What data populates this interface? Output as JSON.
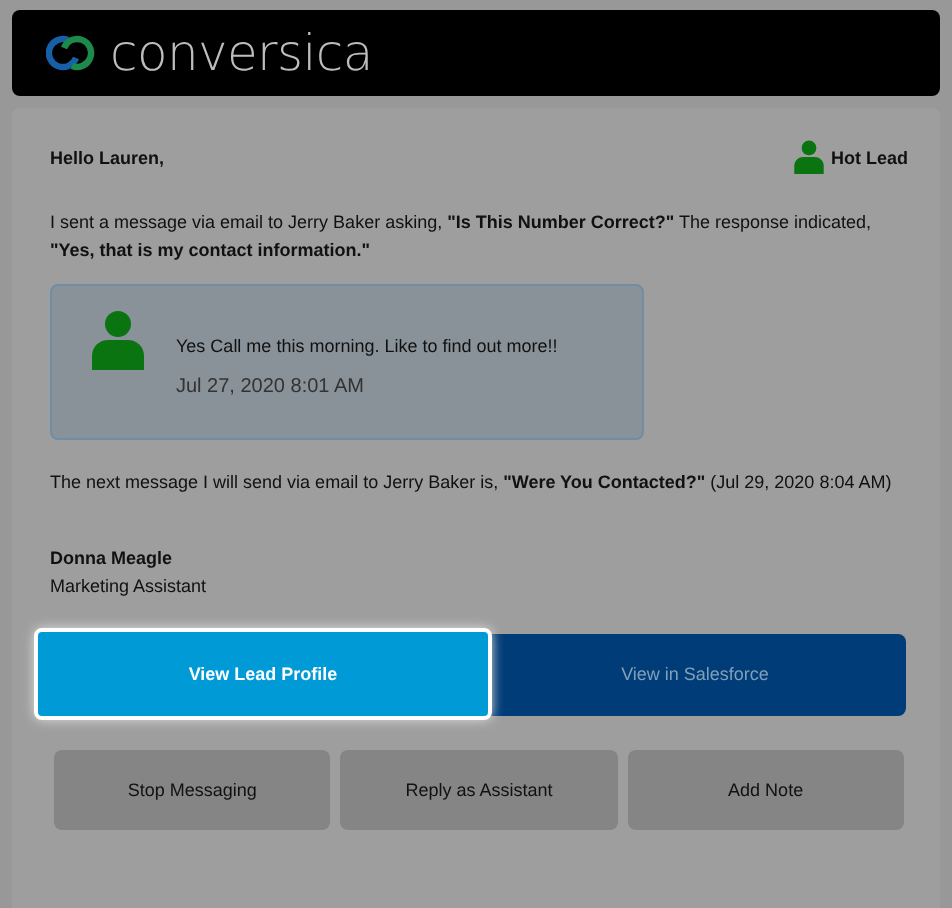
{
  "header": {
    "logo_text": "conversica"
  },
  "greeting": "Hello Lauren,",
  "lead_badge": {
    "label": "Hot Lead"
  },
  "intro": "I sent a message via email to Jerry Baker asking, **\"Is This Number Correct?\"** The response indicated, **\"Yes, that is my contact information.\"**",
  "reply": {
    "text": "Yes Call me this morning. Like to find out more!!",
    "time": "Jul 27, 2020 8:01 AM"
  },
  "next_message": "The next message I will send via email to Jerry Baker is, **\"Were You Contacted?\"** (Jul 29, 2020 8:04 AM)",
  "signature": {
    "name": "Donna Meagle",
    "title": "Marketing Assistant"
  },
  "primary_actions": [
    {
      "label": "View Lead Profile",
      "kind": "light",
      "highlighted": true
    },
    {
      "label": "View in Salesforce",
      "kind": "dark",
      "highlighted": false
    }
  ],
  "secondary_actions": [
    "Stop Messaging",
    "Reply as Assistant",
    "Add Note"
  ]
}
